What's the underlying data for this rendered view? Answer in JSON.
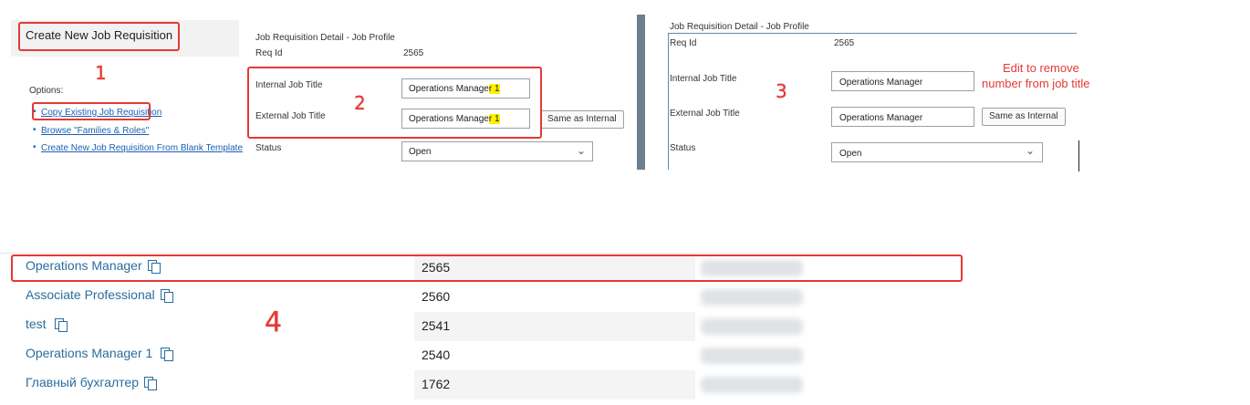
{
  "panel1": {
    "title": "Create New Job Requisition",
    "options_label": "Options:",
    "options": [
      "Copy Existing Job Requisition",
      "Browse \"Families & Roles\"",
      "Create New Job Requisition From Blank Template"
    ],
    "step": "1"
  },
  "panel2": {
    "header": "Job Requisition Detail - Job Profile",
    "req_id_label": "Req Id",
    "req_id_value": "2565",
    "internal_label": "Internal Job Title",
    "internal_value_main": "Operations Manage",
    "internal_value_highlight": "r 1",
    "external_label": "External Job Title",
    "external_value_main": "Operations Manage",
    "external_value_highlight": "r 1",
    "same_as_internal": "Same as Internal",
    "status_label": "Status",
    "status_value": "Open",
    "step": "2"
  },
  "panel3": {
    "header": "Job Requisition Detail - Job Profile",
    "req_id_label": "Req Id",
    "req_id_value": "2565",
    "internal_label": "Internal Job Title",
    "internal_value": "Operations Manager",
    "external_label": "External Job Title",
    "external_value": "Operations Manager",
    "same_as_internal": "Same as Internal",
    "status_label": "Status",
    "status_value": "Open",
    "annotation_line1": "Edit to remove",
    "annotation_line2": "number from job title",
    "step": "3"
  },
  "list": {
    "step": "4",
    "rows": [
      {
        "title": "Operations Manager",
        "id": "2565"
      },
      {
        "title": "Associate Professional",
        "id": "2560"
      },
      {
        "title": "test",
        "id": "2541"
      },
      {
        "title": "Operations Manager 1",
        "id": "2540"
      },
      {
        "title": "Главный бухгалтер",
        "id": "1762"
      }
    ]
  },
  "colors": {
    "annotation_red": "#e53935",
    "highlight_yellow": "#fff200",
    "link_blue": "#1a5fb4",
    "list_title_blue": "#2a6d9e"
  }
}
